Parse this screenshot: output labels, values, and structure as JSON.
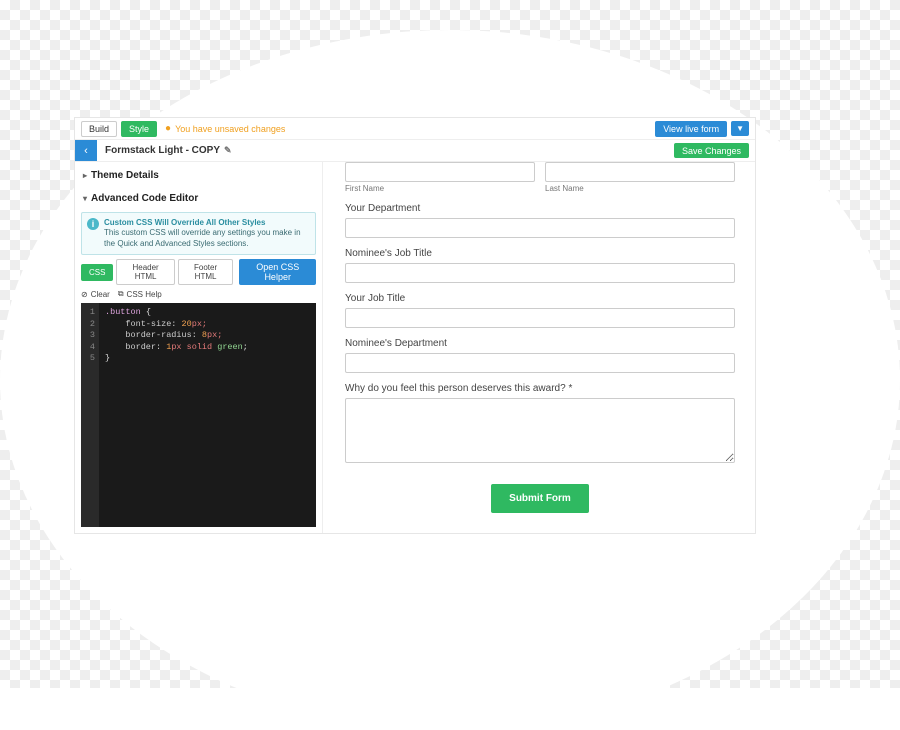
{
  "topbar": {
    "tab_build": "Build",
    "tab_style": "Style",
    "warning": "You have unsaved changes",
    "view_live": "View live form"
  },
  "header": {
    "theme_name": "Formstack Light - COPY",
    "save": "Save Changes"
  },
  "sidebar": {
    "theme_details": "Theme Details",
    "advanced_editor": "Advanced Code Editor",
    "info_title": "Custom CSS Will Override All Other Styles",
    "info_body": "This custom CSS will override any settings you make in the Quick and Advanced Styles sections.",
    "tab_css": "CSS",
    "tab_header": "Header HTML",
    "tab_footer": "Footer HTML",
    "open_helper": "Open CSS Helper",
    "clear": "Clear",
    "css_help": "CSS Help"
  },
  "code": {
    "l1_sel": ".button",
    "l1_brace": " {",
    "l2_prop": "    font-size:",
    "l2_val": " 20",
    "l2_unit": "px;",
    "l3_prop": "    border-radius:",
    "l3_val": " 8",
    "l3_unit": "px;",
    "l4_prop": "    border:",
    "l4_val": " 1",
    "l4_unit": "px ",
    "l4_kw": "solid ",
    "l4_color": "green",
    "l4_sc": ";",
    "l5": "}"
  },
  "form": {
    "first_name": "First Name",
    "last_name": "Last Name",
    "your_department": "Your Department",
    "nominee_job_title": "Nominee's Job Title",
    "your_job_title": "Your Job Title",
    "nominee_department": "Nominee's Department",
    "why": "Why do you feel this person deserves this award? *",
    "submit": "Submit Form"
  }
}
